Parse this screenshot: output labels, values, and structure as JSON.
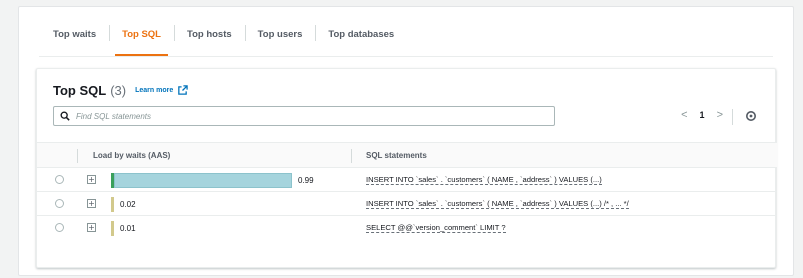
{
  "tabs": [
    {
      "label": "Top waits",
      "active": false
    },
    {
      "label": "Top SQL",
      "active": true
    },
    {
      "label": "Top hosts",
      "active": false
    },
    {
      "label": "Top users",
      "active": false
    },
    {
      "label": "Top databases",
      "active": false
    }
  ],
  "card": {
    "title": "Top SQL",
    "count": "(3)",
    "learn_more": "Learn more"
  },
  "search": {
    "placeholder": "Find SQL statements"
  },
  "pagination": {
    "prev": "<",
    "page": "1",
    "next": ">"
  },
  "table": {
    "columns": [
      "Load by waits (AAS)",
      "SQL statements"
    ],
    "rows": [
      {
        "load": "0.99",
        "load_fraction": 0.99,
        "sql": "INSERT INTO `sales` . `customers` ( NAME , `address` ) VALUES (...)"
      },
      {
        "load": "0.02",
        "load_fraction": 0.02,
        "sql": "INSERT INTO `sales` . `customers` ( NAME , `address` ) VALUES (...) /* , ... */"
      },
      {
        "load": "0.01",
        "load_fraction": 0.01,
        "sql": "SELECT @@`version_comment` LIMIT ?"
      }
    ]
  },
  "colors": {
    "accent": "#ec7211",
    "link": "#0073bb",
    "bar_io": "#a5d4dd",
    "bar_cpu": "#3aa05b",
    "bar_small": "#d2c98c"
  },
  "icons": {
    "external": "external-link-icon",
    "search": "search-icon",
    "settings": "gear-icon",
    "expand": "plus-square-icon"
  }
}
